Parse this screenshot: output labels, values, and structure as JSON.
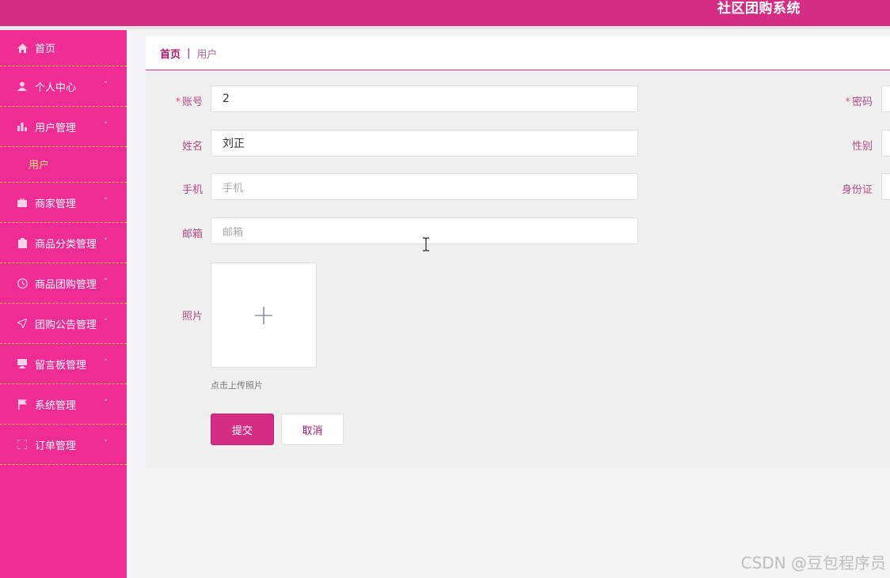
{
  "app": {
    "title": "社区团购系统"
  },
  "sidebar": {
    "items": [
      {
        "label": "首页",
        "icon": "home-icon",
        "expandable": false
      },
      {
        "label": "个人中心",
        "icon": "user-icon",
        "expandable": true
      },
      {
        "label": "用户管理",
        "icon": "bar-chart-icon",
        "expandable": true,
        "expanded": true,
        "children": [
          {
            "label": "用户",
            "active": true
          }
        ]
      },
      {
        "label": "商家管理",
        "icon": "briefcase-icon",
        "expandable": true
      },
      {
        "label": "商品分类管理",
        "icon": "clipboard-icon",
        "expandable": true
      },
      {
        "label": "商品团购管理",
        "icon": "clock-icon",
        "expandable": true
      },
      {
        "label": "团购公告管理",
        "icon": "send-icon",
        "expandable": true
      },
      {
        "label": "留言板管理",
        "icon": "monitor-icon",
        "expandable": true
      },
      {
        "label": "系统管理",
        "icon": "flag-icon",
        "expandable": true
      },
      {
        "label": "订单管理",
        "icon": "fullscreen-icon",
        "expandable": true
      }
    ],
    "arrow_down": "˅",
    "arrow_up": "˄"
  },
  "breadcrumb": {
    "home": "首页",
    "separator": "|",
    "current": "用户"
  },
  "form": {
    "account": {
      "label": "账号",
      "value": "2",
      "required": true
    },
    "password": {
      "label": "密码",
      "required": true
    },
    "name": {
      "label": "姓名",
      "value": "刘正"
    },
    "gender": {
      "label": "性别"
    },
    "phone": {
      "label": "手机",
      "placeholder": "手机"
    },
    "idcard": {
      "label": "身份证"
    },
    "email": {
      "label": "邮箱",
      "placeholder": "邮箱"
    },
    "photo": {
      "label": "照片",
      "hint": "点击上传照片"
    },
    "submit_label": "提交",
    "cancel_label": "取消",
    "required_mark": "*"
  },
  "watermark": "CSDN @豆包程序员",
  "colors": {
    "header": "#d52d84",
    "sidebar": "#f22c95",
    "submenu_active": "#ffe17a",
    "label": "#b44a7f"
  }
}
